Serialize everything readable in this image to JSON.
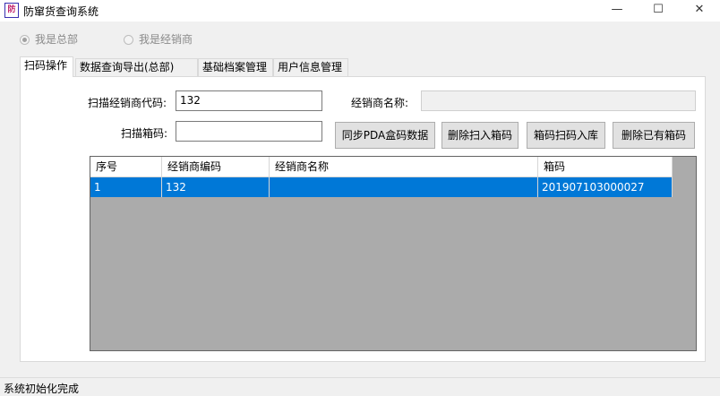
{
  "window": {
    "title": "防窜货查询系统",
    "icon_text": "防",
    "minimize": "—",
    "maximize": "☐",
    "close": "✕"
  },
  "mode": {
    "hq_label": "我是总部",
    "dealer_label": "我是经销商",
    "hq_checked": true
  },
  "tabs": [
    {
      "label": "扫码操作",
      "active": true
    },
    {
      "label": "数据查询导出(总部)",
      "active": false
    },
    {
      "label": "基础档案管理",
      "active": false
    },
    {
      "label": "用户信息管理",
      "active": false
    }
  ],
  "form": {
    "dealer_code_label": "扫描经销商代码:",
    "dealer_code_value": "132",
    "dealer_name_label": "经销商名称:",
    "dealer_name_value": "",
    "box_code_label": "扫描箱码:",
    "box_code_value": ""
  },
  "buttons": {
    "sync_pda": "同步PDA盒码数据",
    "delete_scanned": "删除扫入箱码",
    "box_scan_in": "箱码扫码入库",
    "delete_existing": "删除已有箱码"
  },
  "grid": {
    "columns": [
      "序号",
      "经销商编码",
      "经销商名称",
      "箱码"
    ],
    "rows": [
      {
        "seq": "1",
        "dealer_code": "132",
        "dealer_name": "",
        "box_code": "201907103000027"
      }
    ]
  },
  "status": {
    "text": "系统初始化完成"
  }
}
